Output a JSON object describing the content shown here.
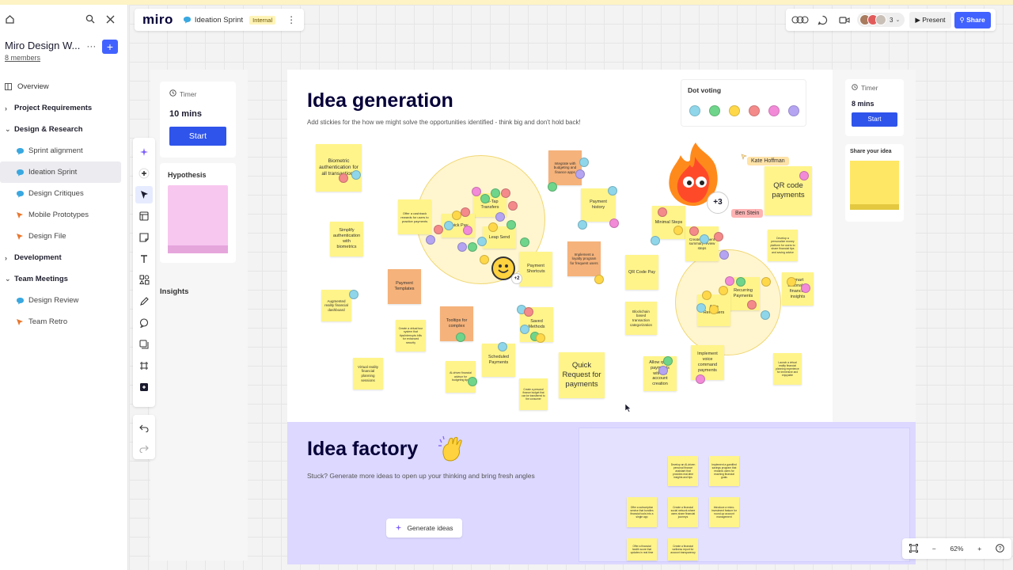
{
  "sidebar": {
    "workspace_name": "Miro Design W...",
    "members_link": "8 members",
    "items": [
      {
        "label": "Overview",
        "type": "page"
      },
      {
        "label": "Project Requirements",
        "type": "section"
      },
      {
        "label": "Design & Research",
        "type": "section"
      },
      {
        "label": "Sprint alignment",
        "type": "board"
      },
      {
        "label": "Ideation Sprint",
        "type": "board"
      },
      {
        "label": "Design Critiques",
        "type": "board"
      },
      {
        "label": "Mobile Prototypes",
        "type": "prototype"
      },
      {
        "label": "Design File",
        "type": "prototype"
      },
      {
        "label": "Development",
        "type": "section"
      },
      {
        "label": "Team Meetings",
        "type": "section"
      },
      {
        "label": "Design Review",
        "type": "board"
      },
      {
        "label": "Team Retro",
        "type": "prototype"
      }
    ]
  },
  "board": {
    "logo": "miro",
    "name": "Ideation Sprint",
    "badge": "Internal"
  },
  "topbar": {
    "avatar_count": "3",
    "present_label": "Present",
    "share_label": "Share"
  },
  "left_panel": {
    "timer_label": "Timer",
    "timer_value": "10 mins",
    "timer_button": "Start",
    "hypothesis_title": "Hypothesis",
    "insights_label": "Insights"
  },
  "idea_generation": {
    "title": "Idea generation",
    "subtitle": "Add stickies for the how we might solve the opportunities identified - think big and don't hold back!",
    "dot_voting_title": "Dot voting",
    "dot_colors": [
      "#8fd6ea",
      "#6fd58a",
      "#ffd84a",
      "#f48a8a",
      "#f28ad8",
      "#b4a4f2"
    ],
    "timer_label": "Timer",
    "timer_value": "8 mins",
    "timer_button": "Start",
    "share_idea_title": "Share your idea",
    "user_tags": {
      "kate": "Kate Hoffman",
      "ben": "Ben Stein",
      "plus_count": "+3",
      "small_plus": "+2"
    },
    "stickies": [
      {
        "text": "Biometric authentication for all transactions"
      },
      {
        "text": "Offer a cashback rewards for users to practice payments"
      },
      {
        "text": "One-Tap Transfers"
      },
      {
        "text": "Quick Pay"
      },
      {
        "text": "Leap Send"
      },
      {
        "text": "Integrate with budgeting and finance apps"
      },
      {
        "text": "Payment history"
      },
      {
        "text": "Simplify authentication with biometrics"
      },
      {
        "text": "Payment Templates"
      },
      {
        "text": "Implement a loyalty program for frequent users"
      },
      {
        "text": "Payment Shortcuts"
      },
      {
        "text": "QR Code Pay"
      },
      {
        "text": "Minimal Steps"
      },
      {
        "text": "Create payment summary review steps"
      },
      {
        "text": "QR code payments"
      },
      {
        "text": "Develop a personalize money platform for users to share financial tips and saving advice"
      },
      {
        "text": "Augmented reality financial dashboard"
      },
      {
        "text": "Tooltips for complex"
      },
      {
        "text": "Saved Methods"
      },
      {
        "text": "Blockchain based transaction categorization"
      },
      {
        "text": "Recurring Payments"
      },
      {
        "text": "Auto Reminders"
      },
      {
        "text": "Smart actionable financial insights"
      },
      {
        "text": "Create a virtual tour system that tips/interrupts bills for enhanced security"
      },
      {
        "text": "Scheduled Payments"
      },
      {
        "text": "Quick Request for payments"
      },
      {
        "text": "Implement voice command payments"
      },
      {
        "text": "Virtual reality financial planning sessions"
      },
      {
        "text": "AI-driven financial advisor for budgeting tips"
      },
      {
        "text": "Create a personal finance budget that can be transferred to the consumer"
      },
      {
        "text": "Allow quick payments without account creation"
      },
      {
        "text": "Launch a virtual reality financial planning experience for immersive and enjoyable"
      }
    ]
  },
  "idea_factory": {
    "title": "Idea factory",
    "subtitle": "Stuck? Generate more ideas to open up your thinking and bring fresh angles",
    "generate_button": "Generate ideas",
    "stickies": [
      {
        "text": "Develop an AI-driven personal finance assistant that provides real-time insights and tips"
      },
      {
        "text": "Implement a gamified savings program that rewards users for reaching financial goals"
      },
      {
        "text": "Offer a subscription service that bundles financial tools into a single app"
      },
      {
        "text": "Create a financial social network where users share financial journeys"
      },
      {
        "text": "Introduce a micro-investment feature for round-up account management"
      },
      {
        "text": "Offer a financial health score that updates in real time"
      },
      {
        "text": "Create a financial wellness report for account transparency"
      }
    ]
  },
  "zoom": {
    "level": "62%"
  }
}
